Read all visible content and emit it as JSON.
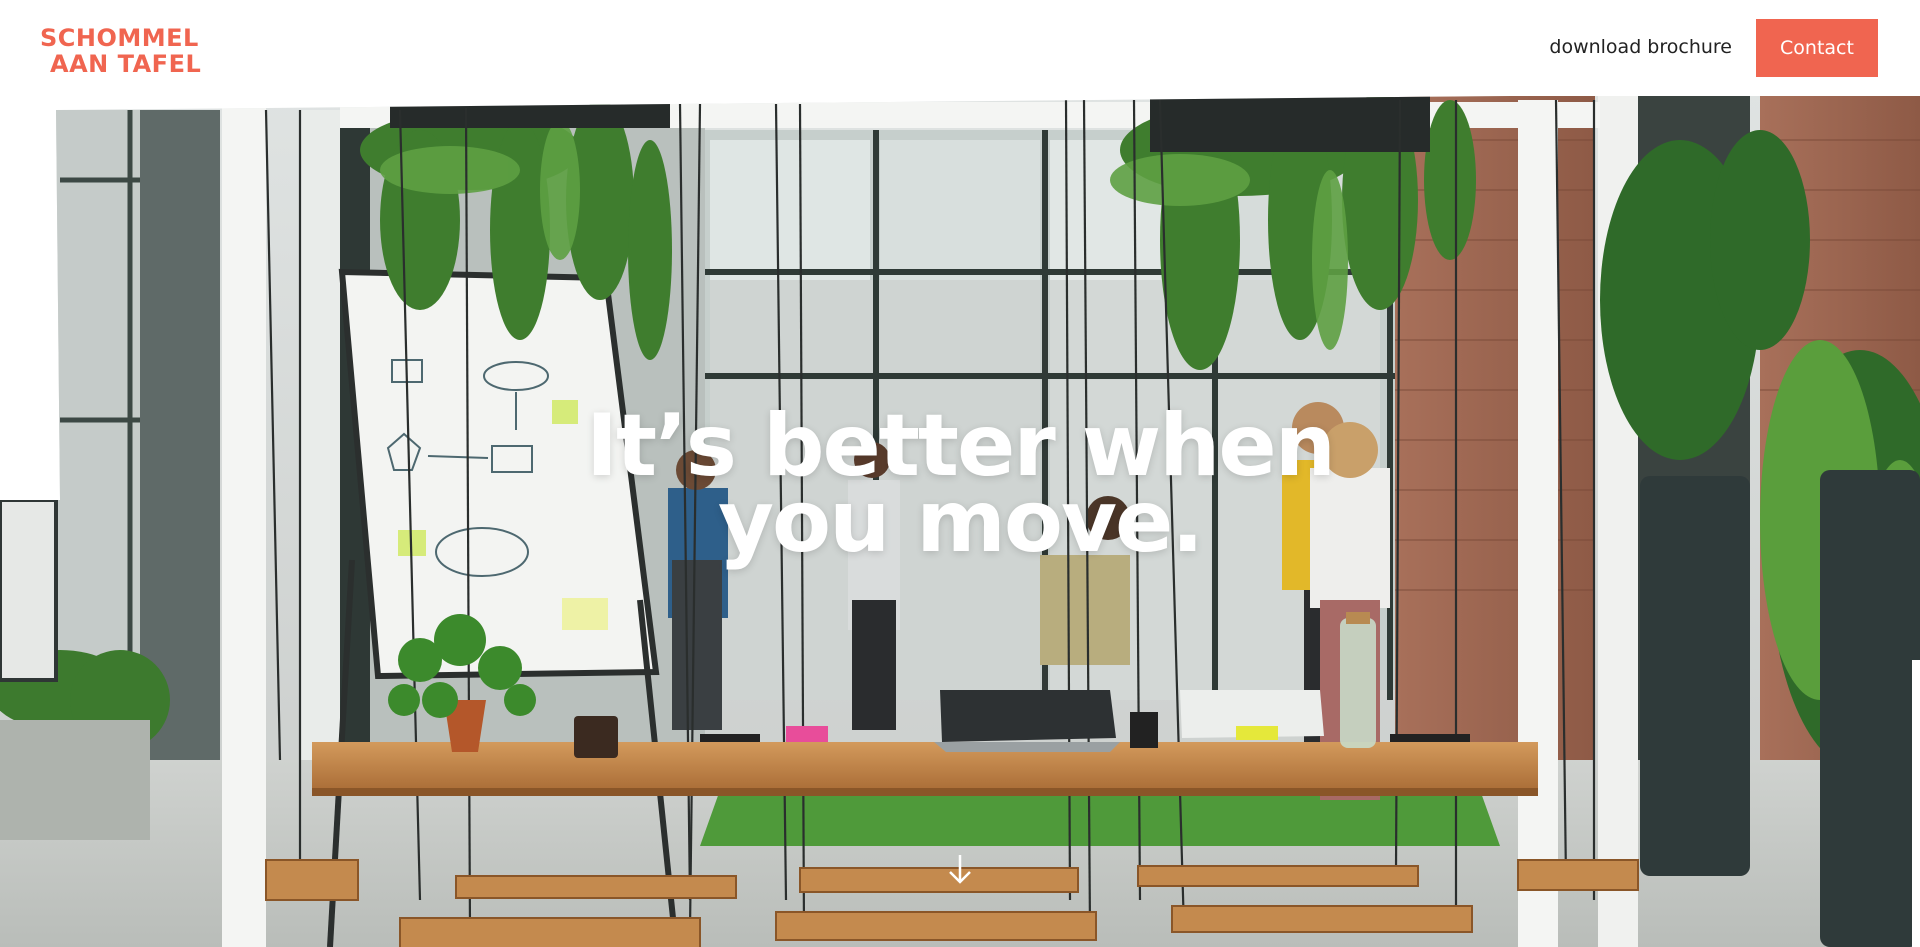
{
  "header": {
    "logo": {
      "line1": "SCHOMMEL",
      "line2": "AAN TAFEL"
    },
    "nav": {
      "brochure_label": "download brochure"
    },
    "contact_label": "Contact"
  },
  "hero": {
    "headline_line1": "It’s better when",
    "headline_line2": "you move."
  },
  "icons": {
    "scroll": "arrow-down-icon"
  },
  "colors": {
    "accent": "#f06550",
    "header_bg": "#ffffff",
    "headline": "#ffffff"
  }
}
